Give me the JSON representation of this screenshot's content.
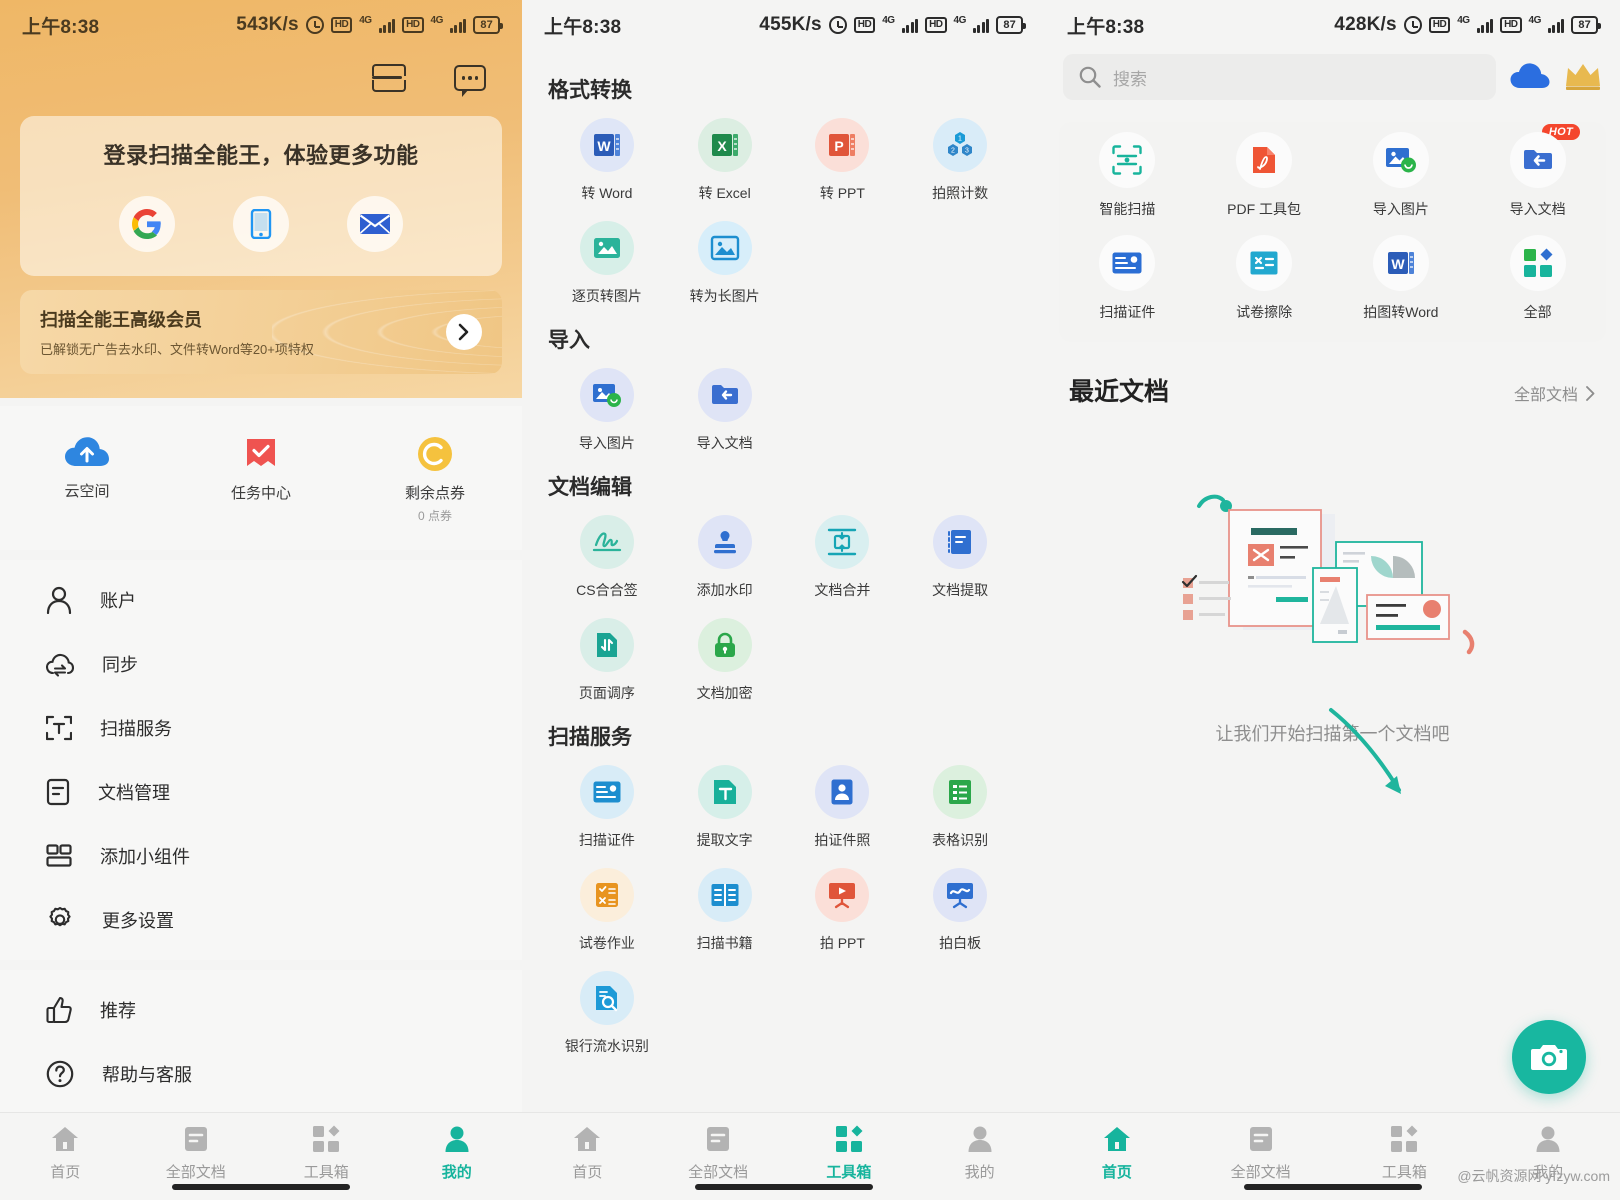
{
  "app": {
    "name": "扫描全能王"
  },
  "panel1": {
    "status": {
      "time": "上午8:38",
      "speed": "543K/s",
      "network": "4G",
      "hd": "HD",
      "battery": "87"
    },
    "header_actions": [
      {
        "name": "split-screen-icon",
        "label": "分屏"
      },
      {
        "name": "feedback-chat-icon",
        "label": "反馈"
      }
    ],
    "login_card": {
      "title": "登录扫描全能王，体验更多功能",
      "buttons": [
        {
          "icon": "google-icon",
          "label": "Google 登录"
        },
        {
          "icon": "phone-icon",
          "label": "手机号登录"
        },
        {
          "icon": "email-icon",
          "label": "邮箱登录"
        }
      ]
    },
    "vip_card": {
      "title": "扫描全能王高级会员",
      "subtitle": "已解锁无广告去水印、文件转Word等20+项特权",
      "arrow": "›"
    },
    "quick_actions": [
      {
        "icon": "cloud-upload-icon",
        "label": "云空间",
        "sub": ""
      },
      {
        "icon": "task-check-icon",
        "label": "任务中心",
        "sub": ""
      },
      {
        "icon": "coupon-coin-icon",
        "label": "剩余点券",
        "sub": "0 点券"
      }
    ],
    "menu_group_1": [
      {
        "icon": "account-person-icon",
        "label": "账户"
      },
      {
        "icon": "sync-cloud-icon",
        "label": "同步"
      },
      {
        "icon": "scan-text-icon",
        "label": "扫描服务"
      },
      {
        "icon": "document-manage-icon",
        "label": "文档管理"
      },
      {
        "icon": "widget-icon",
        "label": "添加小组件"
      },
      {
        "icon": "settings-gear-icon",
        "label": "更多设置"
      }
    ],
    "menu_group_2": [
      {
        "icon": "thumbs-up-icon",
        "label": "推荐"
      },
      {
        "icon": "help-circle-icon",
        "label": "帮助与客服"
      }
    ],
    "tabs": [
      {
        "icon": "home-icon",
        "label": "首页",
        "active": false
      },
      {
        "icon": "documents-icon",
        "label": "全部文档",
        "active": false
      },
      {
        "icon": "toolbox-icon",
        "label": "工具箱",
        "active": false
      },
      {
        "icon": "profile-icon",
        "label": "我的",
        "active": true
      }
    ]
  },
  "panel2": {
    "status": {
      "time": "上午8:38",
      "speed": "455K/s",
      "network": "4G",
      "hd": "HD",
      "battery": "87"
    },
    "sections": [
      {
        "title": "格式转换",
        "tools": [
          {
            "icon": "word-icon",
            "label": "转 Word",
            "bg": "#dfe6f7",
            "color": "#2b5cb8"
          },
          {
            "icon": "excel-icon",
            "label": "转 Excel",
            "bg": "#dceee2",
            "color": "#1f8a4c"
          },
          {
            "icon": "ppt-icon",
            "label": "转 PPT",
            "bg": "#fbdfd8",
            "color": "#e0553a"
          },
          {
            "icon": "photo-count-icon",
            "label": "拍照计数",
            "bg": "#d9ecf8",
            "color": "#1a9bd7"
          },
          {
            "icon": "page-to-image-icon",
            "label": "逐页转图片",
            "bg": "#d7efe8",
            "color": "#2bb39a"
          },
          {
            "icon": "long-image-icon",
            "label": "转为长图片",
            "bg": "#d7eefa",
            "color": "#1d8ecf"
          }
        ]
      },
      {
        "title": "导入",
        "tools": [
          {
            "icon": "import-image-icon",
            "label": "导入图片",
            "bg": "#dfe4f6",
            "color": "#2f6fd0"
          },
          {
            "icon": "import-doc-icon",
            "label": "导入文档",
            "bg": "#dfe4f6",
            "color": "#3a6ed0"
          }
        ]
      },
      {
        "title": "文档编辑",
        "tools": [
          {
            "icon": "signature-icon",
            "label": "CS合合签",
            "bg": "#d9eee8",
            "color": "#2bb39a"
          },
          {
            "icon": "watermark-stamp-icon",
            "label": "添加水印",
            "bg": "#dfe4f6",
            "color": "#2f6fd0"
          },
          {
            "icon": "merge-doc-icon",
            "label": "文档合并",
            "bg": "#d9eff0",
            "color": "#16a5b5"
          },
          {
            "icon": "extract-doc-icon",
            "label": "文档提取",
            "bg": "#dfe4f6",
            "color": "#2f6fd0"
          },
          {
            "icon": "page-order-icon",
            "label": "页面调序",
            "bg": "#d9eee8",
            "color": "#1aa493"
          },
          {
            "icon": "encrypt-lock-icon",
            "label": "文档加密",
            "bg": "#dcf0de",
            "color": "#2ba74a"
          }
        ]
      },
      {
        "title": "扫描服务",
        "tools": [
          {
            "icon": "scan-id-card-icon",
            "label": "扫描证件",
            "bg": "#d8ecf7",
            "color": "#1d8ecf"
          },
          {
            "icon": "extract-text-icon",
            "label": "提取文字",
            "bg": "#d6efe9",
            "color": "#18b09a"
          },
          {
            "icon": "id-photo-icon",
            "label": "拍证件照",
            "bg": "#dfe4f6",
            "color": "#2f6fd0"
          },
          {
            "icon": "table-recognize-icon",
            "label": "表格识别",
            "bg": "#dcf0de",
            "color": "#2ba74a"
          },
          {
            "icon": "exam-homework-icon",
            "label": "试卷作业",
            "bg": "#fbeedb",
            "color": "#e8941f"
          },
          {
            "icon": "scan-book-icon",
            "label": "扫描书籍",
            "bg": "#d8ecf7",
            "color": "#1d8ecf"
          },
          {
            "icon": "capture-ppt-icon",
            "label": "拍 PPT",
            "bg": "#fbdfd8",
            "color": "#e0553a"
          },
          {
            "icon": "whiteboard-icon",
            "label": "拍白板",
            "bg": "#dfe4f6",
            "color": "#2f6fd0"
          },
          {
            "icon": "bank-statement-icon",
            "label": "银行流水识别",
            "bg": "#d8ecf7",
            "color": "#1d9ad7"
          }
        ]
      }
    ],
    "tabs": [
      {
        "icon": "home-icon",
        "label": "首页",
        "active": false
      },
      {
        "icon": "documents-icon",
        "label": "全部文档",
        "active": false
      },
      {
        "icon": "toolbox-icon",
        "label": "工具箱",
        "active": true
      },
      {
        "icon": "profile-icon",
        "label": "我的",
        "active": false
      }
    ]
  },
  "panel3": {
    "status": {
      "time": "上午8:38",
      "speed": "428K/s",
      "network": "4G",
      "hd": "HD",
      "battery": "87"
    },
    "search": {
      "placeholder": "搜索",
      "value": "",
      "icon": "search-icon"
    },
    "header_icons": [
      {
        "icon": "cloud-icon",
        "label": "云空间"
      },
      {
        "icon": "crown-vip-icon",
        "label": "会员"
      }
    ],
    "tools": [
      {
        "icon": "smart-scan-icon",
        "label": "智能扫描",
        "badge": ""
      },
      {
        "icon": "pdf-toolkit-icon",
        "label": "PDF 工具包",
        "badge": ""
      },
      {
        "icon": "import-image-icon",
        "label": "导入图片",
        "badge": ""
      },
      {
        "icon": "import-doc-icon",
        "label": "导入文档",
        "badge": "HOT"
      },
      {
        "icon": "scan-id-card-icon",
        "label": "扫描证件",
        "badge": ""
      },
      {
        "icon": "exam-erase-icon",
        "label": "试卷擦除",
        "badge": ""
      },
      {
        "icon": "photo-to-word-icon",
        "label": "拍图转Word",
        "badge": ""
      },
      {
        "icon": "all-tools-icon",
        "label": "全部",
        "badge": ""
      }
    ],
    "recent": {
      "title": "最近文档",
      "all_label": "全部文档",
      "chevron": "›"
    },
    "empty_state": {
      "text": "让我们开始扫描第一个文档吧",
      "illustration": "document-scan-illustration"
    },
    "fab": {
      "icon": "camera-icon",
      "label": "拍照扫描"
    },
    "tabs": [
      {
        "icon": "home-icon",
        "label": "首页",
        "active": true
      },
      {
        "icon": "documents-icon",
        "label": "全部文档",
        "active": false
      },
      {
        "icon": "toolbox-icon",
        "label": "工具箱",
        "active": false
      },
      {
        "icon": "profile-icon",
        "label": "我的",
        "active": false
      }
    ],
    "watermark": "@云帆资源网 yfzyw.com"
  },
  "colors": {
    "accent": "#17b49d",
    "gold": "#efb766",
    "hot": "#f4462d"
  }
}
